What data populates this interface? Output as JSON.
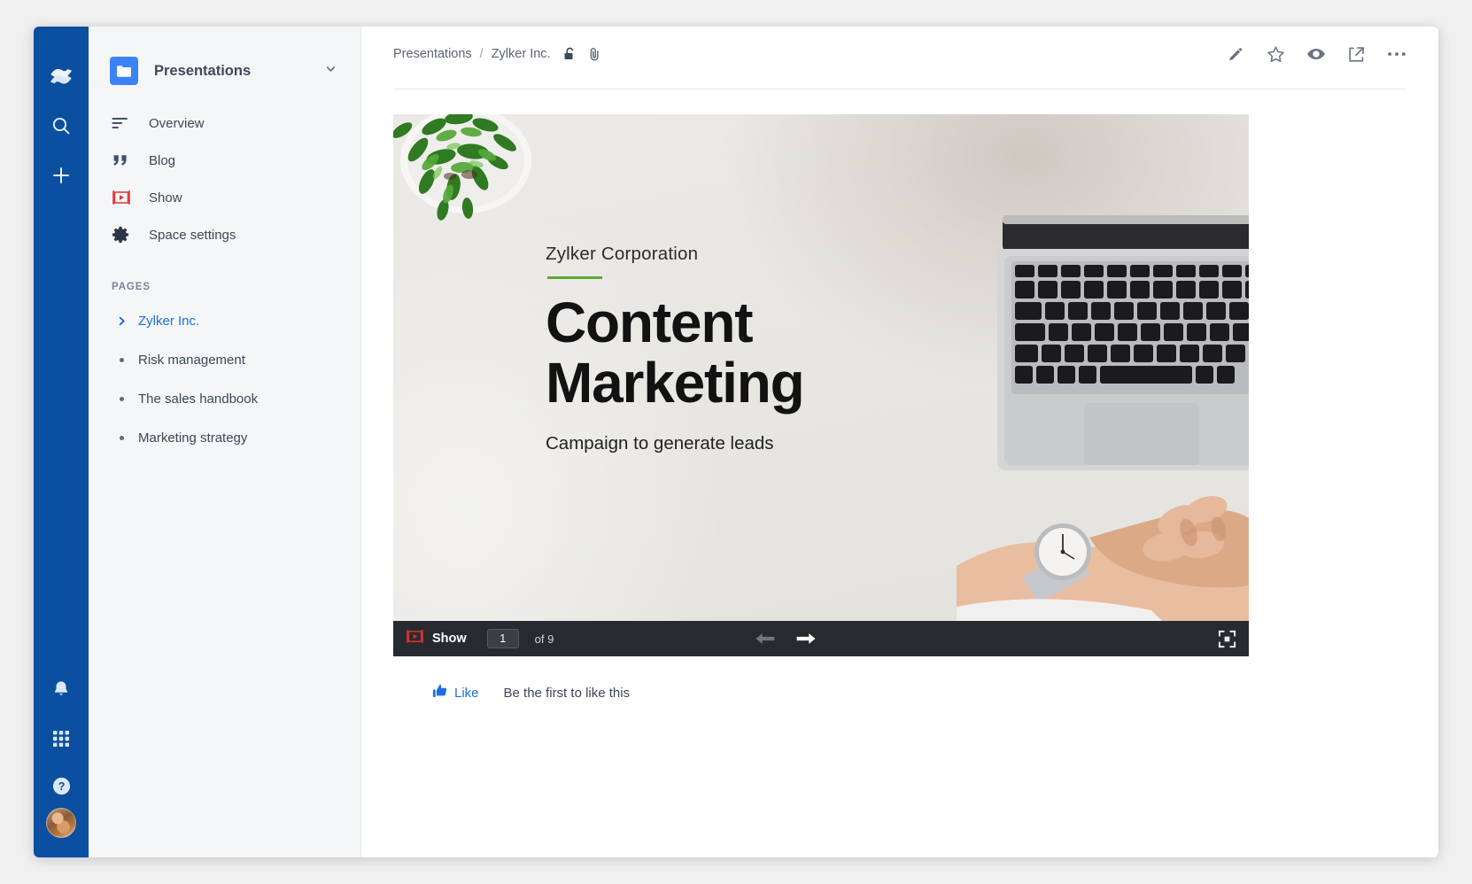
{
  "rail": {
    "items": [
      {
        "name": "confluence-logo-icon",
        "label": "Confluence"
      },
      {
        "name": "search-icon",
        "label": "Search"
      },
      {
        "name": "create-icon",
        "label": "Create"
      }
    ],
    "bottom": [
      {
        "name": "notifications-bell-icon",
        "label": "Notifications"
      },
      {
        "name": "app-switcher-grid-icon",
        "label": "App switcher"
      },
      {
        "name": "help-icon",
        "label": "Help"
      }
    ],
    "avatar_label": "User profile"
  },
  "sidebar": {
    "space_title": "Presentations",
    "space_icon": "folder-icon",
    "chevron": "chevron-down-icon",
    "nav": [
      {
        "label": "Overview",
        "icon": "overview-lines-icon"
      },
      {
        "label": "Blog",
        "icon": "quote-icon"
      },
      {
        "label": "Show",
        "icon": "show-play-icon"
      },
      {
        "label": "Space settings",
        "icon": "gear-icon"
      }
    ],
    "pages_heading": "PAGES",
    "pages": [
      {
        "label": "Zylker Inc.",
        "active": true,
        "marker": "chevron-right-icon"
      },
      {
        "label": "Risk management",
        "active": false,
        "marker": "dot"
      },
      {
        "label": "The sales handbook",
        "active": false,
        "marker": "dot"
      },
      {
        "label": "Marketing strategy",
        "active": false,
        "marker": "dot"
      }
    ]
  },
  "topbar": {
    "breadcrumb": {
      "space": "Presentations",
      "separator": "/",
      "page": "Zylker Inc."
    },
    "breadcrumb_icons": [
      {
        "name": "unlock-icon",
        "label": "Restrictions"
      },
      {
        "name": "attachment-icon",
        "label": "Attachments"
      }
    ],
    "actions": [
      {
        "name": "edit-pencil-icon",
        "label": "Edit"
      },
      {
        "name": "star-icon",
        "label": "Save for later"
      },
      {
        "name": "watch-eye-icon",
        "label": "Watch"
      },
      {
        "name": "share-icon",
        "label": "Share"
      },
      {
        "name": "more-ellipsis-icon",
        "label": "More actions"
      }
    ]
  },
  "slide": {
    "kicker": "Zylker Corporation",
    "title_line1": "Content",
    "title_line2": "Marketing",
    "subtitle": "Campaign to generate leads",
    "accent_color": "#5aa832"
  },
  "player": {
    "brand_label": "Show",
    "brand_icon": "show-play-icon",
    "current_page": "1",
    "total_label": "of 9",
    "prev_icon": "arrow-left-icon",
    "next_icon": "arrow-right-icon",
    "fullscreen_icon": "fullscreen-icon",
    "prev_enabled": false,
    "next_enabled": true
  },
  "footer": {
    "like_label": "Like",
    "like_icon": "thumbs-up-icon",
    "like_note": "Be the first to like this"
  }
}
